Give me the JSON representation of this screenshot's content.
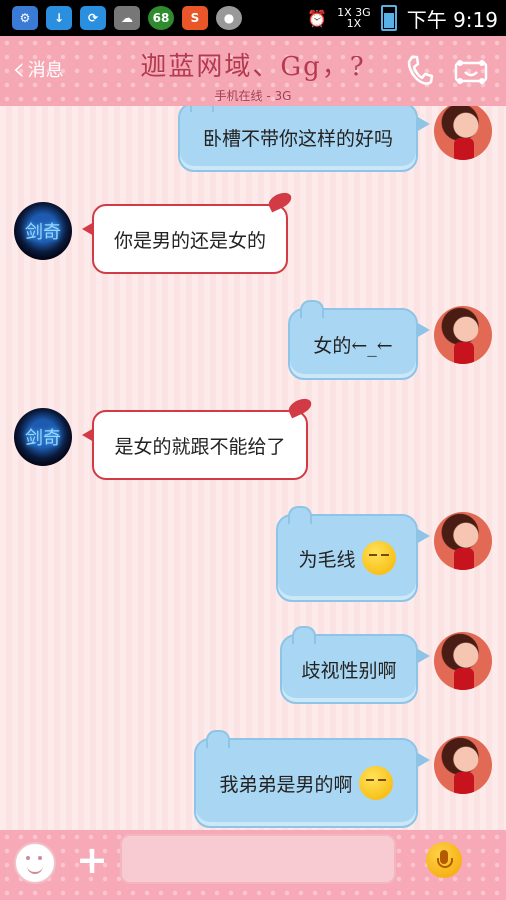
{
  "status_bar": {
    "time": "下午 9:19",
    "network_1": "1X 3G",
    "network_2": "1X",
    "battery_icon": "battery-icon",
    "notification_badge": "68"
  },
  "header": {
    "back_label": "消息",
    "title": "迦蓝网域、Gg，?",
    "subtitle": "手机在线 - 3G",
    "call_icon": "phone-icon",
    "profile_icon": "profile-card-icon"
  },
  "messages": [
    {
      "from": "me",
      "text": "卧槽不带你这样的好吗",
      "emoji": false
    },
    {
      "from": "other",
      "text": "你是男的还是女的",
      "emoji": false
    },
    {
      "from": "me",
      "text": "女的←_←",
      "emoji": false
    },
    {
      "from": "other",
      "text": "是女的就跟不能给了",
      "emoji": false
    },
    {
      "from": "me",
      "text": "为毛线",
      "emoji": true
    },
    {
      "from": "me",
      "text": "歧视性别啊",
      "emoji": false
    },
    {
      "from": "me",
      "text": "我弟弟是男的啊",
      "emoji": true
    }
  ],
  "other_avatar_label": "剑奇",
  "bottom_bar": {
    "emoji_icon": "smiley-icon",
    "plus_icon": "plus-icon",
    "input_placeholder": "",
    "mic_icon": "microphone-icon"
  },
  "colors": {
    "header_bg": "#f6a7b4",
    "my_bubble": "#a9d7f3",
    "other_bubble_border": "#d23a46"
  }
}
